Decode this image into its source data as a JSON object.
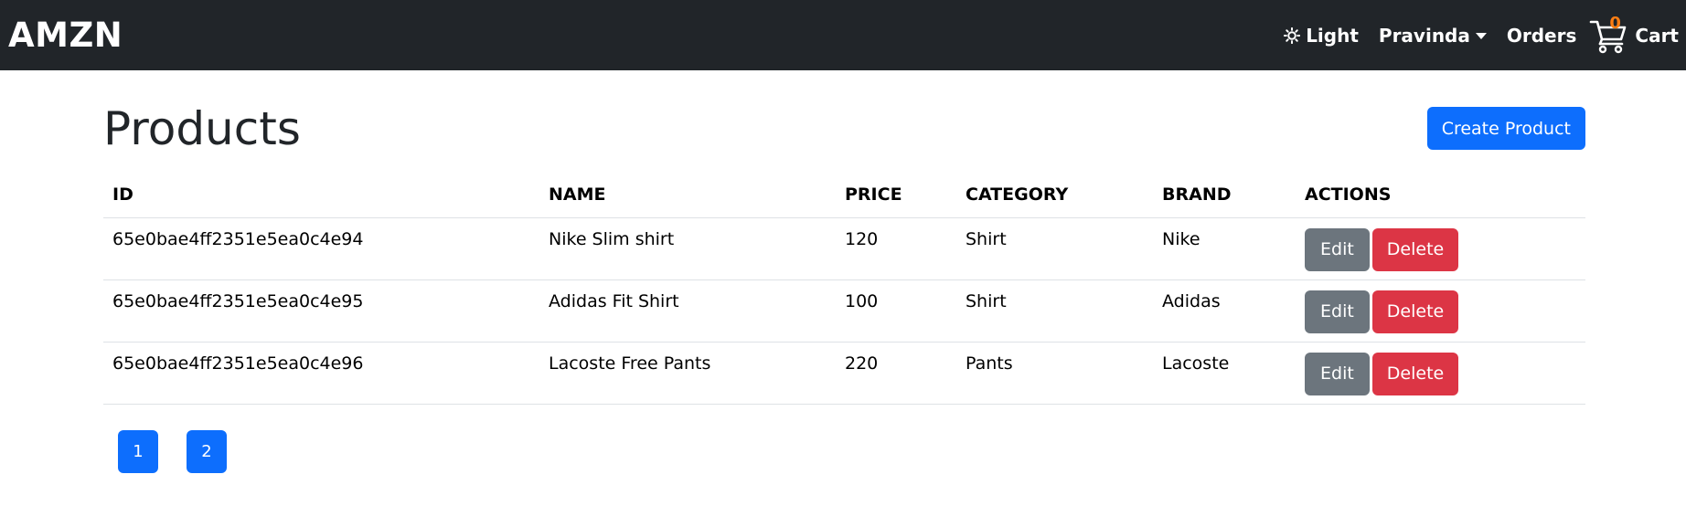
{
  "navbar": {
    "brand": "AMZN",
    "theme_label": "Light",
    "user_label": "Pravinda",
    "orders_label": "Orders",
    "cart_label": "Cart",
    "cart_count": "0"
  },
  "page": {
    "title": "Products",
    "create_button": "Create Product"
  },
  "table": {
    "headers": [
      "ID",
      "NAME",
      "PRICE",
      "CATEGORY",
      "BRAND",
      "ACTIONS"
    ],
    "edit_label": "Edit",
    "delete_label": "Delete",
    "rows": [
      {
        "id": "65e0bae4ff2351e5ea0c4e94",
        "name": "Nike Slim shirt",
        "price": "120",
        "category": "Shirt",
        "brand": "Nike"
      },
      {
        "id": "65e0bae4ff2351e5ea0c4e95",
        "name": "Adidas Fit Shirt",
        "price": "100",
        "category": "Shirt",
        "brand": "Adidas"
      },
      {
        "id": "65e0bae4ff2351e5ea0c4e96",
        "name": "Lacoste Free Pants",
        "price": "220",
        "category": "Pants",
        "brand": "Lacoste"
      }
    ]
  },
  "pagination": {
    "pages": [
      "1",
      "2"
    ]
  },
  "colors": {
    "navbar_bg": "#212529",
    "primary": "#0d6efd",
    "secondary": "#6c757d",
    "danger": "#dc3545",
    "badge": "#fd7e14"
  },
  "icons": {
    "theme": "sun-icon",
    "cart": "cart-icon"
  }
}
